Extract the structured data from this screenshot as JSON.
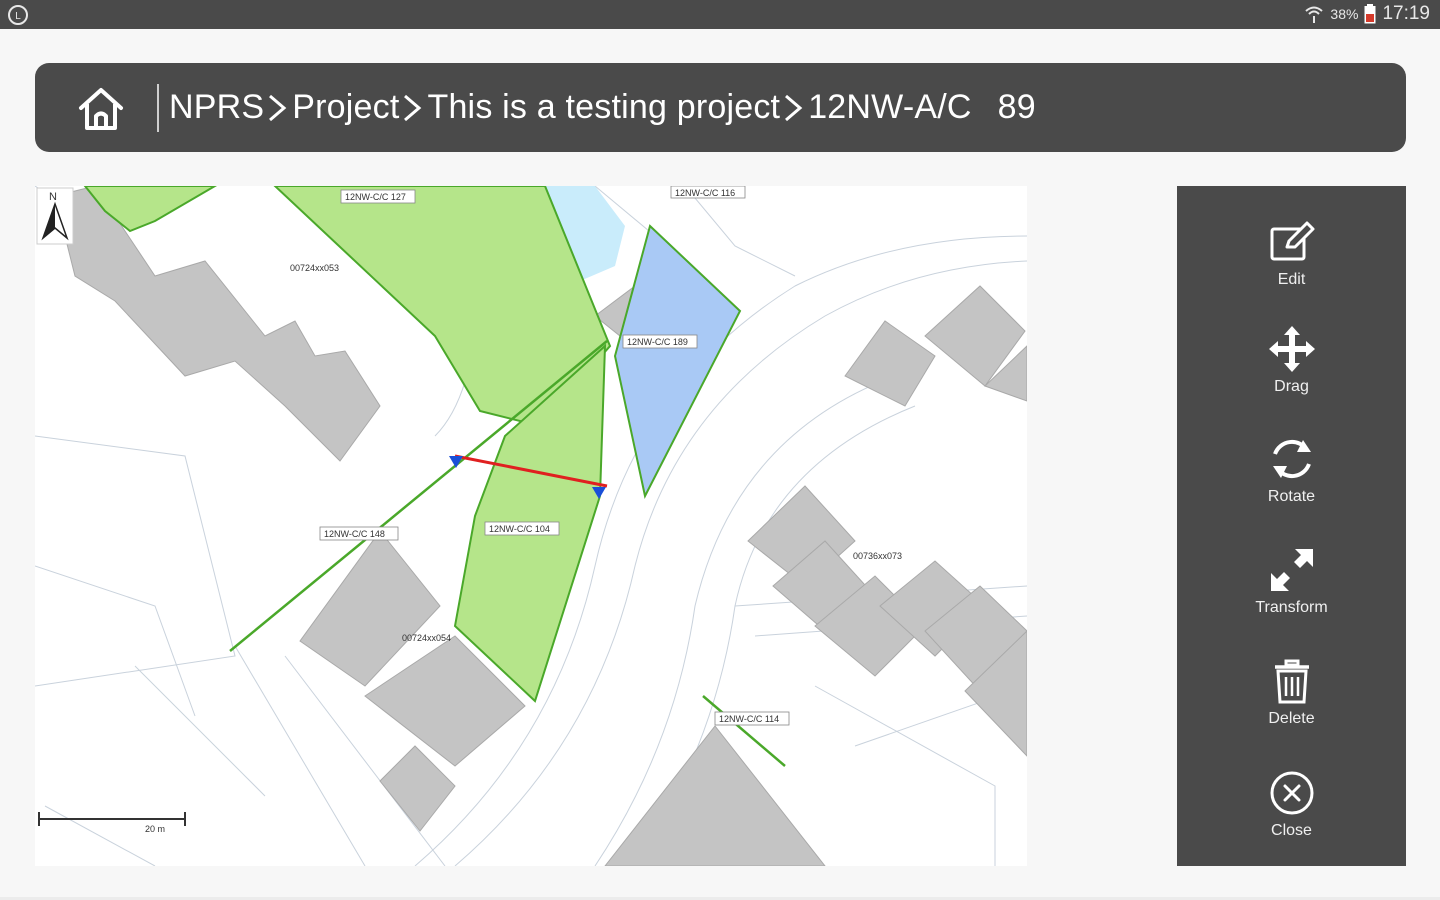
{
  "status_bar": {
    "battery_percent": "38%",
    "time": "17:19"
  },
  "breadcrumb": {
    "items": [
      "NPRS",
      "Project",
      "This is a testing project",
      "12NW-A/C"
    ],
    "count": "89"
  },
  "map": {
    "labels": {
      "lot_189": "12NW-C/C 189",
      "lot_127": "12NW-C/C 127",
      "lot_116": "12NW-C/C 116",
      "lot_148": "12NW-C/C 148",
      "lot_114": "12NW-C/C 114",
      "lot_104": "12NW-C/C 104",
      "lot_a": "00724xx053",
      "lot_b": "00724xx054",
      "lot_c": "00736xx073",
      "scale": "20 m"
    }
  },
  "toolbar": {
    "edit": "Edit",
    "drag": "Drag",
    "rotate": "Rotate",
    "transform": "Transform",
    "delete": "Delete",
    "close": "Close"
  },
  "colors": {
    "chrome": "#4a4a4a",
    "green_parcel": "#b5e58a",
    "blue_parcel": "#a9c9f5",
    "building": "#bdbdbd",
    "measure_line": "#e02020"
  }
}
